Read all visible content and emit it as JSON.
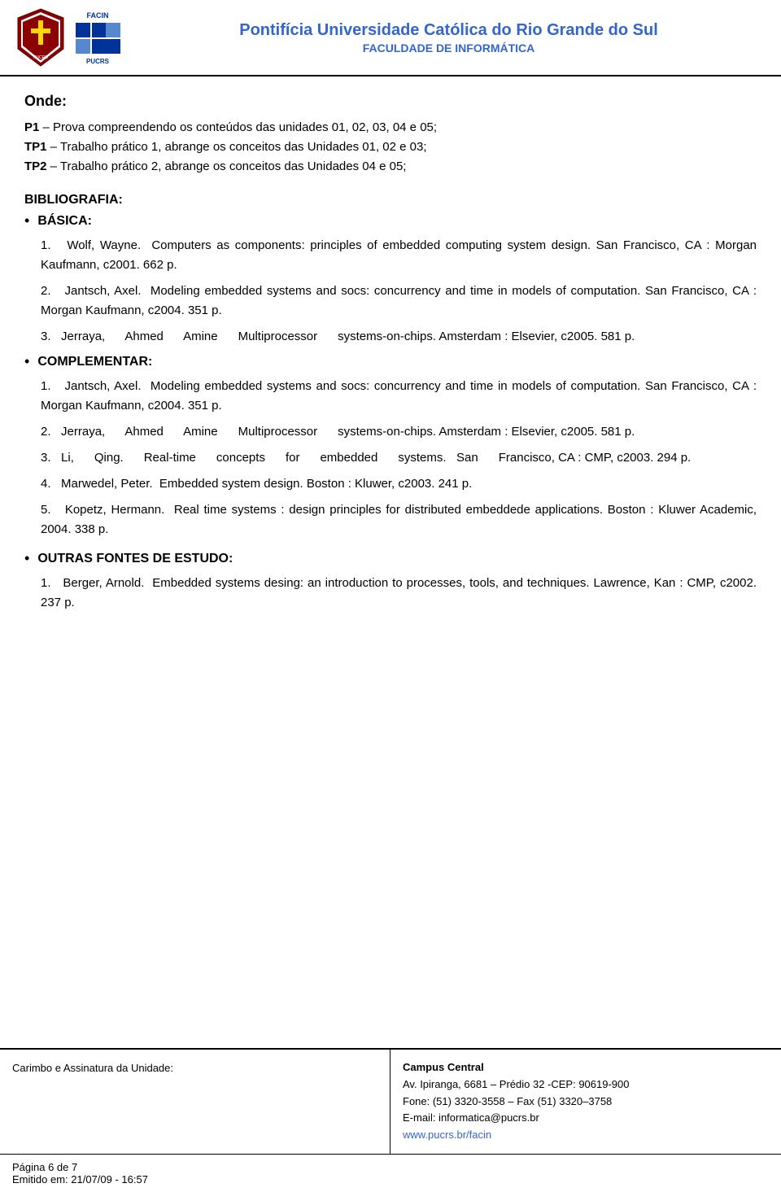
{
  "header": {
    "university_name": "Pontifícia Universidade Católica do Rio Grande do Sul",
    "faculty_name": "FACULDADE DE INFORMÁTICA"
  },
  "onde": {
    "title": "Onde:",
    "items": [
      "P1 – Prova compreendendo os conteúdos das unidades 01, 02, 03, 04 e 05;",
      "TP1 – Trabalho prático 1, abrange os conceitos das Unidades 01, 02 e 03;",
      "TP2 – Trabalho prático 2, abrange os conceitos das Unidades 04 e 05;"
    ]
  },
  "bibliography": {
    "heading": "BIBLIOGRAFIA:",
    "basic_label": "BÁSICA:",
    "basic_items": [
      {
        "number": "1.",
        "text": "Wolf, Wayne. Computers as components: principles of embedded computing system design. San Francisco, CA : Morgan Kaufmann, c2001. 662 p."
      },
      {
        "number": "2.",
        "text": "Jantsch, Axel. Modeling embedded systems and socs: concurrency and time in models of computation. San Francisco, CA : Morgan Kaufmann, c2004. 351 p."
      },
      {
        "number": "3.",
        "text": "Jerraya, Ahmed Amine  Multiprocessor  systems-on-chips. Amsterdam : Elsevier, c2005. 581 p."
      }
    ],
    "complementar_label": "COMPLEMENTAR:",
    "complementar_items": [
      {
        "number": "1.",
        "text": "Jantsch, Axel. Modeling embedded systems and socs: concurrency and time in models of computation. San Francisco, CA : Morgan Kaufmann, c2004. 351 p."
      },
      {
        "number": "2.",
        "text": "Jerraya, Ahmed Amine  Multiprocessor  systems-on-chips. Amsterdam : Elsevier, c2005. 581 p."
      },
      {
        "number": "3.",
        "text": "Li, Qing. Real-time concepts for embedded systems. San Francisco, CA : CMP, c2003. 294 p."
      },
      {
        "number": "4.",
        "text": "Marwedel, Peter. Embedded system design. Boston : Kluwer, c2003. 241 p."
      },
      {
        "number": "5.",
        "text": "Kopetz, Hermann. Real time systems : design principles for distributed embeddede applications. Boston : Kluwer Academic, 2004. 338 p."
      }
    ],
    "other_sources_label": "OUTRAS FONTES DE ESTUDO:",
    "other_sources_items": [
      {
        "number": "1.",
        "text": "Berger, Arnold. Embedded systems desing: an introduction to processes, tools, and techniques. Lawrence, Kan : CMP, c2002. 237 p."
      }
    ]
  },
  "footer": {
    "left_label": "Carimbo e Assinatura da Unidade:",
    "campus_title": "Campus Central",
    "address": "Av. Ipiranga, 6681 – Prédio 32 -CEP: 90619-900",
    "phone": "Fone: (51) 3320-3558 – Fax (51) 3320–3758",
    "email": "E-mail: informatica@pucrs.br",
    "website": "www.pucrs.br/facin",
    "page_info": "Página 6 de 7",
    "emitted": "Emitido em: 21/07/09 - 16:57"
  }
}
